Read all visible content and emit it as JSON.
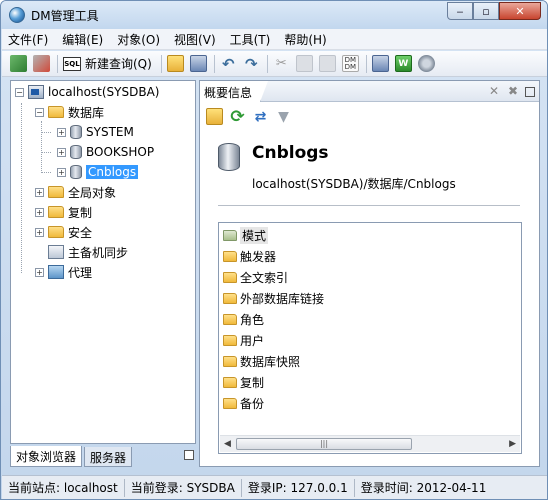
{
  "window": {
    "title": "DM管理工具",
    "minimize": "‒",
    "maximize": "▫",
    "close": "✕"
  },
  "menu": [
    "文件(F)",
    "编辑(E)",
    "对象(O)",
    "视图(V)",
    "工具(T)",
    "帮助(H)"
  ],
  "toolbar": {
    "sql_icon_text": "SQL",
    "new_query": "新建查询(Q)",
    "dm_icon_text": "DM DM",
    "icons": [
      "connect-icon",
      "disconnect-icon",
      "sql-icon",
      "open-folder-icon",
      "save-icon",
      "undo-icon",
      "redo-icon",
      "cut-icon",
      "copy-icon",
      "paste-icon",
      "dm-compare-icon",
      "export-icon",
      "monitor-icon",
      "settings-icon"
    ]
  },
  "tree": {
    "root": "localhost(SYSDBA)",
    "databases_folder": "数据库",
    "databases": [
      "SYSTEM",
      "BOOKSHOP",
      "Cnblogs"
    ],
    "selected": "Cnblogs",
    "folders": [
      "全局对象",
      "复制",
      "安全"
    ],
    "sync": "主备机同步",
    "proxy": "代理"
  },
  "left_tabs": [
    "对象浏览器",
    "服务器"
  ],
  "overview": {
    "tab": "概要信息",
    "title": "Cnblogs",
    "path": "localhost(SYSDBA)/数据库/Cnblogs",
    "items": [
      "模式",
      "触发器",
      "全文索引",
      "外部数据库链接",
      "角色",
      "用户",
      "数据库快照",
      "复制",
      "备份"
    ],
    "scroll_grip": "|||"
  },
  "status": {
    "site": "当前站点: localhost",
    "login": "当前登录: SYSDBA",
    "ip": "登录IP: 127.0.0.1",
    "time": "登录时间: 2012-04-11"
  },
  "colors": {
    "selection": "#3399ff",
    "panel_border": "#8a9bb2",
    "title_gradient_top": "#dce9f7"
  }
}
